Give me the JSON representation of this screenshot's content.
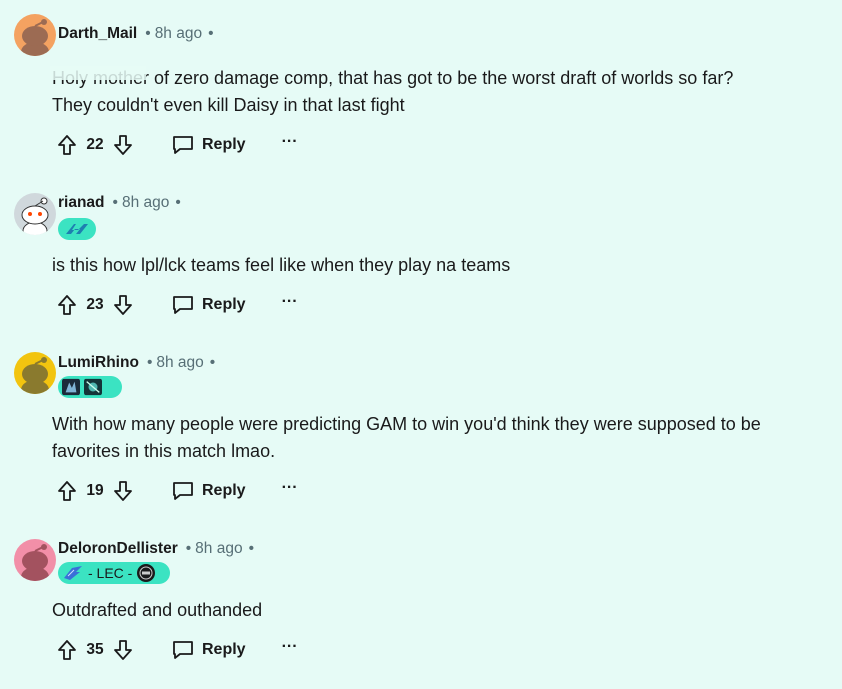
{
  "colors": {
    "background": "#e6fbf6",
    "flair_bg": "#3be3c2",
    "muted_text": "#576f76"
  },
  "comments": [
    {
      "username": "Darth_Mail",
      "time": "8h ago",
      "avatar_color": "#f4a261",
      "body_lines": [
        "Holy mother of zero damage comp, that has got to be the worst draft of worlds so far?",
        "They couldn't even kill Daisy in that last fight"
      ],
      "score": "22",
      "reply_label": "Reply",
      "more_label": "···"
    },
    {
      "username": "rianad",
      "time": "8h ago",
      "avatar_color": "#d0d8dc",
      "flair_icon": "clg-logo-icon",
      "body_lines": [
        "is this how lpl/lck teams feel like when they play na teams"
      ],
      "score": "23",
      "reply_label": "Reply",
      "more_label": "···"
    },
    {
      "username": "LumiRhino",
      "time": "8h ago",
      "avatar_color": "#f2c40f",
      "flair_icons": [
        "champion-portrait-1-icon",
        "champion-portrait-2-icon"
      ],
      "body_lines": [
        "With how many people were predicting GAM to win you'd think they were supposed to be",
        "favorites in this match lmao."
      ],
      "score": "19",
      "reply_label": "Reply",
      "more_label": "···"
    },
    {
      "username": "DeloronDellister",
      "time": "8h ago",
      "avatar_color": "#f28fa8",
      "flair_text": "- LEC -",
      "flair_icons": [
        "lec-bird-icon",
        "team-logo-icon"
      ],
      "body_lines": [
        "Outdrafted and outhanded"
      ],
      "score": "35",
      "reply_label": "Reply",
      "more_label": "···"
    }
  ]
}
